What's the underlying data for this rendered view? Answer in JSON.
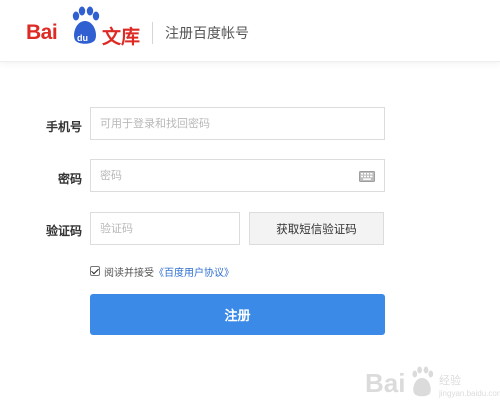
{
  "header": {
    "brand_bai": "Bai",
    "brand_du": "du",
    "brand_wenku": "文库",
    "title": "注册百度帐号"
  },
  "form": {
    "phone": {
      "label": "手机号",
      "placeholder": "可用于登录和找回密码",
      "value": ""
    },
    "password": {
      "label": "密码",
      "placeholder": "密码",
      "value": "",
      "icon": "keyboard-icon"
    },
    "captcha": {
      "label": "验证码",
      "placeholder": "验证码",
      "value": ""
    },
    "sms_button": "获取短信验证码",
    "agree": {
      "checked": true,
      "text": "阅读并接受",
      "link": "《百度用户协议》"
    },
    "submit": "注册"
  },
  "watermark": {
    "brand": "Bai",
    "sub": "经验",
    "url": "jingyan.baidu.com"
  },
  "colors": {
    "brand_red": "#de2a24",
    "brand_blue": "#2f5fd0",
    "primary_button": "#3c8ae8",
    "link": "#2f6fd2"
  }
}
